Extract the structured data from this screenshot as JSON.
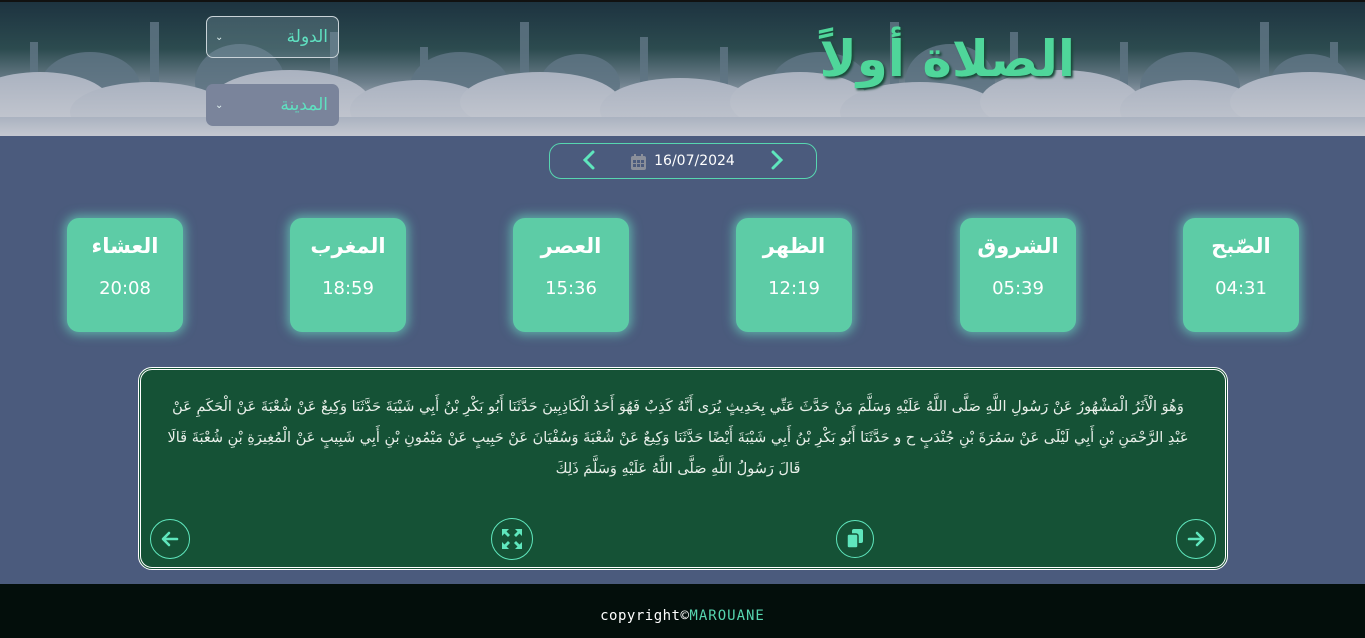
{
  "header": {
    "title": "الصلاة أولاً",
    "country_select": {
      "label": "الدولة"
    },
    "city_select": {
      "label": "المدينة"
    }
  },
  "date_nav": {
    "date": "16/07/2024",
    "prev_icon": "chevron-left-icon",
    "next_icon": "chevron-right-icon",
    "calendar_icon": "calendar-icon"
  },
  "prayers": [
    {
      "name": "العشاء",
      "time": "20:08"
    },
    {
      "name": "المغرب",
      "time": "18:59"
    },
    {
      "name": "العصر",
      "time": "15:36"
    },
    {
      "name": "الظهر",
      "time": "12:19"
    },
    {
      "name": "الشروق",
      "time": "05:39"
    },
    {
      "name": "الصّبح",
      "time": "04:31"
    }
  ],
  "hadith": {
    "text": "وَهُوَ الْأَثَرُ الْمَشْهُورُ عَنْ رَسُولِ اللَّهِ صَلَّى اللَّهُ عَلَيْهِ وَسَلَّمَ مَنْ حَدَّثَ عَنِّي بِحَدِيثٍ يُرَى أَنَّهُ كَذِبٌ فَهُوَ أَحَدُ الْكَاذِبِينَ حَدَّثَنَا أَبُو بَكْرِ بْنُ أَبِي شَيْبَةَ حَدَّثَنَا وَكِيعٌ عَنْ شُعْبَةَ عَنْ الْحَكَمِ عَنْ عَبْدِ الرَّحْمَنِ بْنِ أَبِي لَيْلَى عَنْ سَمُرَةَ بْنِ جُنْدَبٍ ح و حَدَّثَنَا أَبُو بَكْرِ بْنُ أَبِي شَيْبَةَ أَيْضًا حَدَّثَنَا وَكِيعٌ عَنْ شُعْبَةَ وَسُفْيَانَ عَنْ حَبِيبٍ عَنْ مَيْمُونِ بْنِ أَبِي شَبِيبٍ عَنْ الْمُغِيرَةِ بْنِ شُعْبَةَ قَالَا قَالَ رَسُولُ اللَّهِ صَلَّى اللَّهُ عَلَيْهِ وَسَلَّمَ ذَلِكَ"
  },
  "footer": {
    "copyright": "copyright©",
    "author": "MAROUANE"
  },
  "colors": {
    "accent": "#57d6b0",
    "card": "#5dcca6",
    "hadith_bg": "#155236",
    "page_bg": "#4b5b7d",
    "title": "#4fd69a"
  }
}
